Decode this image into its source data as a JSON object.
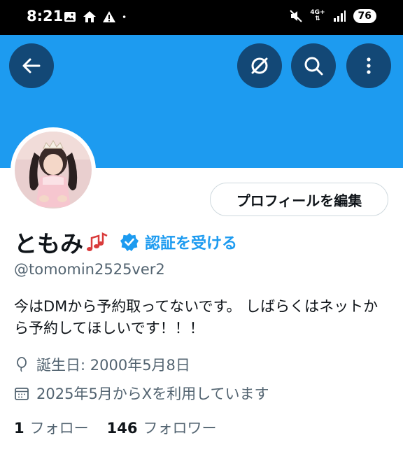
{
  "status_bar": {
    "time": "8:21",
    "battery": "76",
    "network": "4G+",
    "left_icons": [
      "image-icon",
      "home-icon",
      "warning-icon",
      "dot-icon"
    ],
    "right_icons": [
      "mute-icon",
      "network-icon",
      "signal-icon",
      "battery-icon"
    ]
  },
  "header": {
    "accent_color": "#1d9bf0",
    "buttons": [
      "back-arrow-icon",
      "grok-icon",
      "search-icon",
      "more-vertical-icon"
    ]
  },
  "profile": {
    "edit_button_label": "プロフィールを編集",
    "display_name": "ともみ",
    "name_emoji": "music-notes-icon",
    "verify_label": "認証を受ける",
    "handle": "@tomomin2525ver2",
    "bio": "今はDMから予約取ってないです。 しばらくはネットから予約してほしいです！！！",
    "birthday": "誕生日: 2000年5月8日",
    "joined": "2025年5月からXを利用しています",
    "following_count": "1",
    "following_label": "フォロー",
    "followers_count": "146",
    "followers_label": "フォロワー"
  }
}
